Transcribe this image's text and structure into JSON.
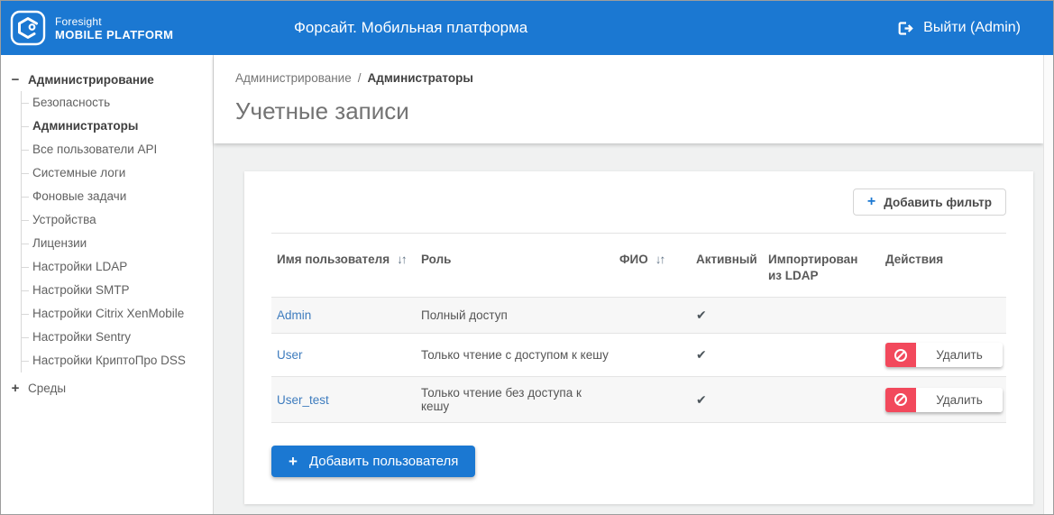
{
  "header": {
    "logo_line1": "Foresight",
    "logo_line2": "MOBILE PLATFORM",
    "app_title": "Форсайт. Мобильная платформа",
    "logout_label": "Выйти (Admin)"
  },
  "sidebar": {
    "section_label": "Администрирование",
    "collapse_icon": "−",
    "expand_icon": "+",
    "items": [
      {
        "label": "Безопасность"
      },
      {
        "label": "Администраторы",
        "active": true
      },
      {
        "label": "Все пользователи API"
      },
      {
        "label": "Системные логи"
      },
      {
        "label": "Фоновые задачи"
      },
      {
        "label": "Устройства"
      },
      {
        "label": "Лицензии"
      },
      {
        "label": "Настройки LDAP"
      },
      {
        "label": "Настройки SMTP"
      },
      {
        "label": "Настройки Citrix XenMobile"
      },
      {
        "label": "Настройки Sentry"
      },
      {
        "label": "Настройки КриптоПро DSS"
      }
    ],
    "collapsed_section_label": "Среды"
  },
  "breadcrumb": {
    "parent": "Администрирование",
    "separator": "/",
    "current": "Администраторы"
  },
  "page_title": "Учетные записи",
  "filters": {
    "plus_icon": "+",
    "add_filter_label": "Добавить фильтр"
  },
  "table": {
    "columns": {
      "username": "Имя пользователя",
      "role": "Роль",
      "fio": "ФИО",
      "active": "Активный",
      "imported": "Импортирован из LDAP",
      "actions": "Действия"
    },
    "sort_icon": "↓↑",
    "check_icon": "✔",
    "delete_label": "Удалить",
    "rows": [
      {
        "username": "Admin",
        "role": "Полный доступ",
        "fio": "",
        "active": true,
        "imported": ""
      },
      {
        "username": "User",
        "role": "Только чтение с доступом к кешу",
        "fio": "",
        "active": true,
        "imported": ""
      },
      {
        "username": "User_test",
        "role": "Только чтение без доступа к кешу",
        "fio": "",
        "active": true,
        "imported": ""
      }
    ]
  },
  "buttons": {
    "plus_icon": "+",
    "add_user_label": "Добавить пользователя"
  },
  "colors": {
    "header_blue": "#1b78d2",
    "link_blue": "#3e7cbe",
    "delete_red": "#f2495c",
    "page_bg": "#f0f1f1"
  }
}
